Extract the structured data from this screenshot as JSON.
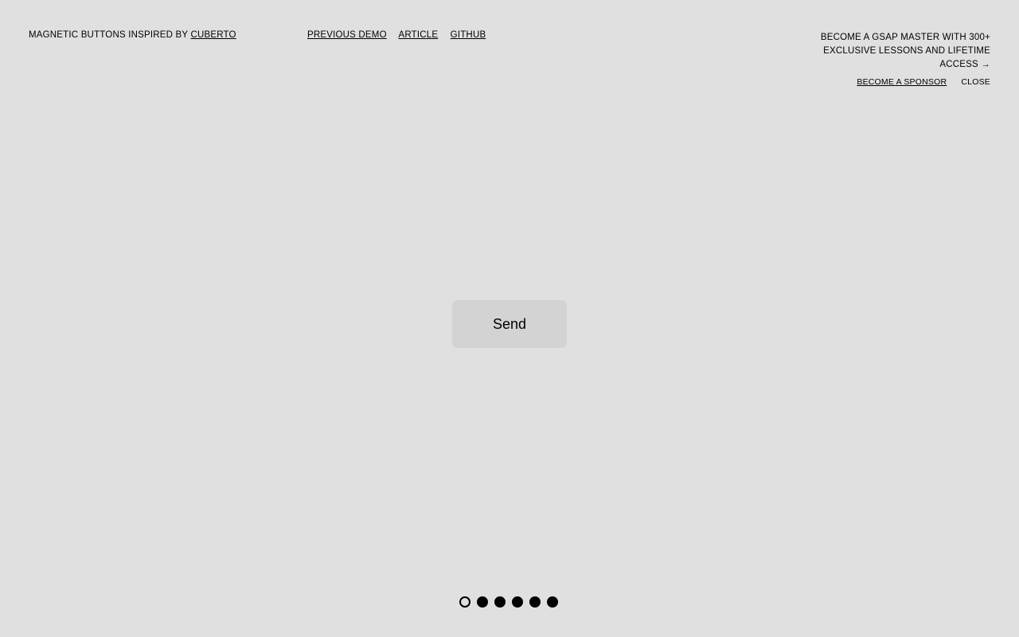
{
  "header": {
    "title_prefix": "MAGNETIC BUTTONS INSPIRED BY",
    "title_link": "CUBERTO"
  },
  "nav": {
    "links": [
      {
        "label": "PREVIOUS DEMO"
      },
      {
        "label": "ARTICLE"
      },
      {
        "label": "GITHUB"
      }
    ]
  },
  "sponsor": {
    "text": "BECOME A GSAP MASTER WITH 300+ EXCLUSIVE LESSONS AND LIFETIME ACCESS →",
    "sponsor_link": "BECOME A SPONSOR",
    "close_label": "CLOSE"
  },
  "main": {
    "button_label": "Send"
  },
  "pagination": {
    "active_index": 0,
    "count": 6
  },
  "colors": {
    "background": "#e0e0e0",
    "button_bg": "#d3d3d3",
    "text": "#000000"
  }
}
